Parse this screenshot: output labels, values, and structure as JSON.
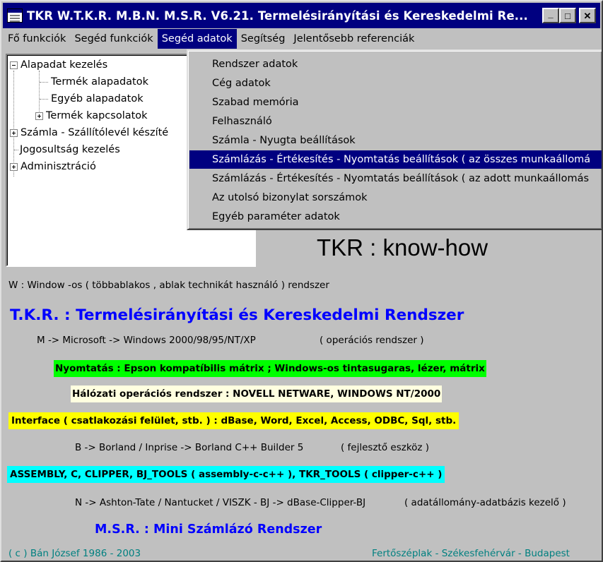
{
  "window": {
    "title": "TKR W.T.K.R. M.B.N. M.S.R. V6.21. Termelésirányítási és Kereskedelmi Re...",
    "controls": {
      "minimize": "_",
      "maximize": "□",
      "close": "✕"
    }
  },
  "menubar": {
    "items": [
      {
        "label": "Fő funkciók"
      },
      {
        "label": "Segéd funkciók"
      },
      {
        "label": "Segéd adatok"
      },
      {
        "label": "Segítség"
      },
      {
        "label": "Jelentősebb referenciák"
      }
    ],
    "active_index": 2
  },
  "tree": {
    "items": [
      {
        "label": "Alapadat kezelés",
        "expander": "minus"
      },
      {
        "label": "Termék alapadatok"
      },
      {
        "label": "Egyéb alapadatok"
      },
      {
        "label": "Termék kapcsolatok",
        "expander": "plus"
      },
      {
        "label": "Számla - Szállítólevél készíté",
        "expander": "plus"
      },
      {
        "label": "Jogosultság kezelés"
      },
      {
        "label": "Adminisztráció",
        "expander": "plus"
      }
    ]
  },
  "dropdown": {
    "items": [
      {
        "label": "Rendszer adatok"
      },
      {
        "label": "Cég adatok"
      },
      {
        "label": "Szabad memória"
      },
      {
        "label": "Felhasználó"
      },
      {
        "label": "Számla - Nyugta beállítások"
      },
      {
        "label": "Számlázás - Értékesítés - Nyomtatás beállítások ( az összes munkaállomá"
      },
      {
        "label": "Számlázás - Értékesítés - Nyomtatás beállítások ( az adott munkaállomás"
      },
      {
        "label": "Az utolsó bizonylat sorszámok"
      },
      {
        "label": "Egyéb paraméter adatok"
      }
    ],
    "highlighted_index": 5
  },
  "main": {
    "knowhow": "TKR :  know-how",
    "w_line": "W : Window -os ( többablakos , ablak technikát használó ) rendszer",
    "tkr_title": "T.K.R. : Termelésirányítási és Kereskedelmi Rendszer",
    "m_line": "M -> Microsoft -> Windows 2000/98/95/NT/XP",
    "m_note": "( operációs rendszer )",
    "nyomtatas": "Nyomtatás : Epson kompatíbilis mátrix ;  Windows-os tintasugaras, lézer, mátrix",
    "halozati": "Hálózati operációs rendszer : NOVELL NETWARE, WINDOWS NT/2000",
    "interface": "Interface ( csatlakozási felület, stb. )  : dBase, Word, Excel, Access, ODBC, Sql, stb.",
    "b_line": "B -> Borland / Inprise -> Borland C++ Builder 5",
    "b_note": "( fejlesztő eszköz )",
    "assembly": "ASSEMBLY, C, CLIPPER, BJ_TOOLS ( assembly-c-c++ ), TKR_TOOLS ( clipper-c++ )",
    "n_line": "N -> Ashton-Tate / Nantucket / VISZK - BJ -> dBase-Clipper-BJ",
    "n_note": "( adatállomány-adatbázis kezelő )",
    "msr": "M.S.R. : Mini Számlázó Rendszer",
    "copyright": "( c ) Bán József 1986 - 2003",
    "places": "Fertőszéplak - Székesfehérvár - Budapest"
  },
  "colors": {
    "titlebar": "#000080",
    "blue_text": "#0000ff",
    "teal_text": "#008080",
    "green_band": "#00ff00",
    "yellow_band": "#ffff00",
    "cream_band": "#ffffe0",
    "cyan_band": "#00ffff"
  }
}
